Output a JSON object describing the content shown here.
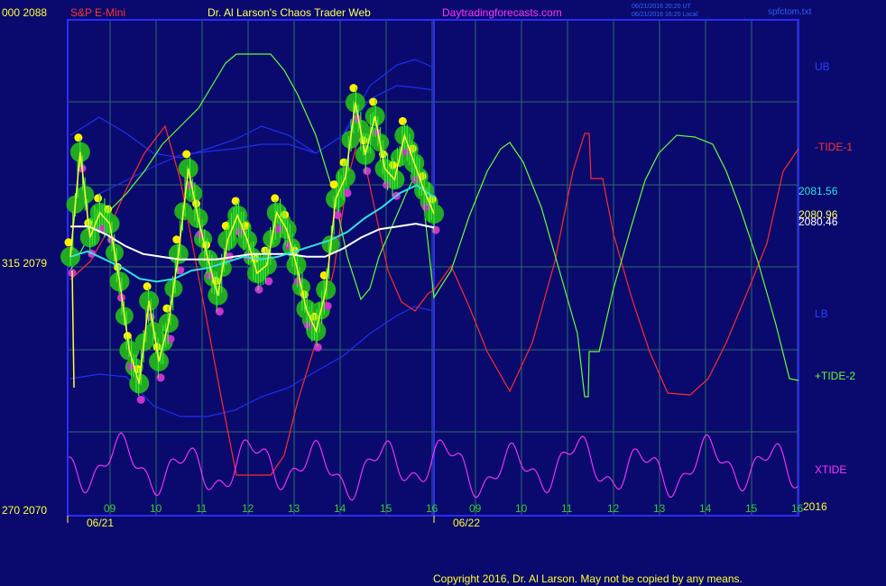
{
  "header": {
    "left_scale": "000  2088",
    "symbol": "S&P E-Mini",
    "title": "Dr. Al Larson's Chaos Trader Web",
    "website": "Daytradingforecasts.com",
    "update_line1": "06/21/2016 20:20 UT",
    "update_line2": "06/21/2016 16:20 Local",
    "file": "spfctom.txt"
  },
  "left_axis": {
    "mid": "315  2079",
    "bottom": "270  2070"
  },
  "right_labels": {
    "ub": "UB",
    "tide1": "-TIDE-1",
    "price_cyan": "2081.56",
    "price_yellow": "2080.96",
    "price_white": "2080.46",
    "lb": "LB",
    "tide2": "+TIDE-2",
    "xtide": "XTIDE",
    "year": "2016"
  },
  "x_axis": {
    "hours": [
      "09",
      "10",
      "11",
      "12",
      "13",
      "14",
      "15",
      "16",
      "09",
      "10",
      "11",
      "12",
      "13",
      "14",
      "15",
      "16"
    ],
    "dates": [
      "06/21",
      "06/22"
    ]
  },
  "copyright": "Copyright 2016, Dr. Al Larson. May not be copied by any means.",
  "colors": {
    "background": "#0a0a6e",
    "grid": "#2c6a6a",
    "frame": "#2b2bff",
    "bands": "#1e2ef0",
    "tide1": "#ff2a2a",
    "tide2": "#66ff33",
    "xtide": "#ff33ff",
    "price_line": "#ffff33",
    "ma_cyan": "#33e0e0",
    "ma_white": "#ffffff",
    "bars": "#33ee33",
    "dot_green": "#22aa22",
    "dot_yellow": "#ffee00",
    "dot_magenta": "#cc33cc"
  },
  "chart_data": {
    "type": "line",
    "title": "S&P E-Mini",
    "xlabel": "",
    "ylabel": "",
    "ylim": [
      2070,
      2088
    ],
    "series": [
      {
        "name": "-TIDE-1"
      },
      {
        "name": "+TIDE-2"
      },
      {
        "name": "XTIDE"
      },
      {
        "name": "UB"
      },
      {
        "name": "LB"
      },
      {
        "name": "",
        "values": [
          2079.4,
          2083.2,
          2080.1,
          2081.0,
          2080.6,
          2078.5,
          2076.0,
          2074.8,
          2077.8,
          2075.6,
          2077.0,
          2079.5,
          2082.6,
          2080.8,
          2079.3,
          2078.0,
          2080.0,
          2080.9,
          2080.0,
          2078.8,
          2079.1,
          2081.0,
          2080.4,
          2079.1,
          2077.5,
          2076.7,
          2078.2,
          2081.5,
          2082.3,
          2085.0,
          2083.1,
          2084.5,
          2082.6,
          2082.2,
          2083.8,
          2082.8,
          2081.8,
          2080.96
        ]
      },
      {
        "name": "",
        "values": [
          2079.4,
          2079.6,
          2079.3,
          2079.0,
          2078.6,
          2078.5,
          2078.6,
          2078.9,
          2079.0,
          2079.2,
          2079.4,
          2079.3,
          2079.4,
          2079.6,
          2079.8,
          2080.0,
          2080.3,
          2080.8,
          2081.2,
          2081.7,
          2082.0,
          2081.56
        ]
      },
      {
        "name": "",
        "values": [
          2080.5,
          2080.5,
          2080.2,
          2079.8,
          2079.5,
          2079.4,
          2079.3,
          2079.3,
          2079.3,
          2079.4,
          2079.5,
          2079.5,
          2079.5,
          2079.4,
          2079.4,
          2079.7,
          2080.1,
          2080.4,
          2080.5,
          2080.6,
          2080.46
        ]
      }
    ],
    "x_ticks": [
      "09",
      "10",
      "11",
      "12",
      "13",
      "14",
      "15",
      "16",
      "09",
      "10",
      "11",
      "12",
      "13",
      "14",
      "15",
      "16"
    ],
    "y_ticks": [
      "2088",
      "2079",
      "2070"
    ],
    "grid": true,
    "legend": "right"
  }
}
